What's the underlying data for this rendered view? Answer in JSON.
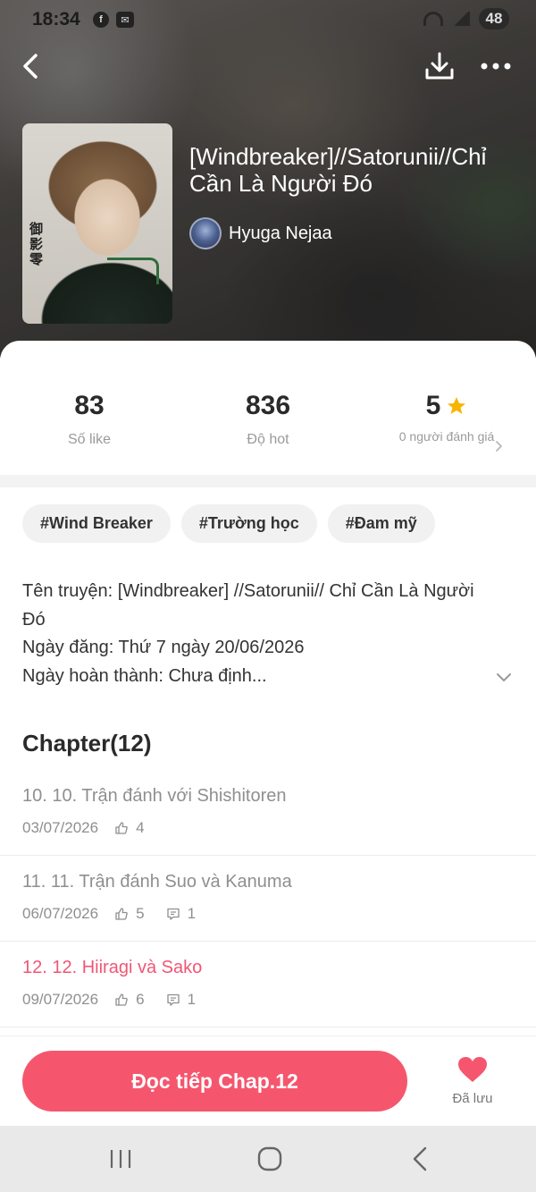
{
  "status_bar": {
    "time": "18:34",
    "left_icons": [
      "facebook-icon",
      "messenger-icon"
    ],
    "battery": "48"
  },
  "book": {
    "title": "[Windbreaker]//Satorunii//Chỉ Cần Là Người Đó",
    "author": "Hyuga Nejaa",
    "cover_vertical_text": "御影零"
  },
  "stats": {
    "likes_value": "83",
    "likes_label": "Số like",
    "hot_value": "836",
    "hot_label": "Độ hot",
    "rating_value": "5",
    "rating_label": "0 người đánh giá"
  },
  "tags": [
    "#Wind Breaker",
    "#Trường học",
    "#Đam mỹ"
  ],
  "description": {
    "line1": "Tên truyện: [Windbreaker] //Satorunii// Chỉ Cần Là Người Đó",
    "line2": "Ngày đăng: Thứ 7 ngày 20/06/2026",
    "line3": "Ngày hoàn thành: Chưa định..."
  },
  "chapters": {
    "heading": "Chapter(12)",
    "items": [
      {
        "title": "10. 10. Trận đánh với Shishitoren",
        "date": "03/07/2026",
        "likes": "4",
        "comments": null
      },
      {
        "title": "11. 11. Trận đánh Suo và Kanuma",
        "date": "06/07/2026",
        "likes": "5",
        "comments": "1"
      },
      {
        "title": "12. 12. Hiiragi và Sako",
        "date": "09/07/2026",
        "likes": "6",
        "comments": "1"
      }
    ]
  },
  "actions": {
    "read_button": "Đọc tiếp Chap.12",
    "save_label": "Đã lưu"
  },
  "colors": {
    "accent": "#f5566e",
    "active_chapter": "#f05674",
    "star": "#f7b500"
  }
}
